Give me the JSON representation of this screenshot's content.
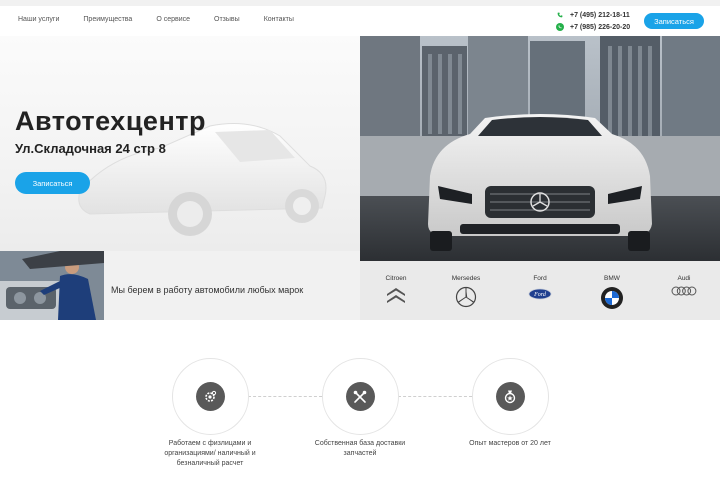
{
  "nav": {
    "items": [
      {
        "label": "Наши услуги"
      },
      {
        "label": "Преимущества"
      },
      {
        "label": "О сервисе"
      },
      {
        "label": "Отзывы"
      },
      {
        "label": "Контакты"
      }
    ]
  },
  "contacts": {
    "phone1": "+7 (495) 212-18-11",
    "phone2": "+7 (985) 226-20-20",
    "phone1_icon": "phone-icon",
    "phone2_icon": "whatsapp-icon"
  },
  "header": {
    "cta_label": "Записаться"
  },
  "hero": {
    "title": "Автотехцентр",
    "address": "Ул.Складочная 24 стр 8",
    "cta_label": "Записаться"
  },
  "service": {
    "text": "Мы берем в работу автомобили любых марок"
  },
  "brands": [
    {
      "name": "Citroen",
      "icon": "citroen-logo-icon"
    },
    {
      "name": "Mersedes",
      "icon": "mercedes-logo-icon"
    },
    {
      "name": "Ford",
      "icon": "ford-logo-icon"
    },
    {
      "name": "BMW",
      "icon": "bmw-logo-icon"
    },
    {
      "name": "Audi",
      "icon": "audi-logo-icon"
    }
  ],
  "features": [
    {
      "line1": "Работаем с физлицами и",
      "line2": "организациями/ наличный и",
      "line3": "безналичный расчет",
      "icon": "gears-icon"
    },
    {
      "line1": "Собственная база доставки",
      "line2": "запчастей",
      "icon": "tools-icon"
    },
    {
      "line1": "Опыт мастеров от 20 лет",
      "icon": "master-badge-icon"
    }
  ],
  "colors": {
    "accent": "#1aa3e8",
    "whatsapp": "#25b04a",
    "feature_icon_bg": "#595959"
  }
}
